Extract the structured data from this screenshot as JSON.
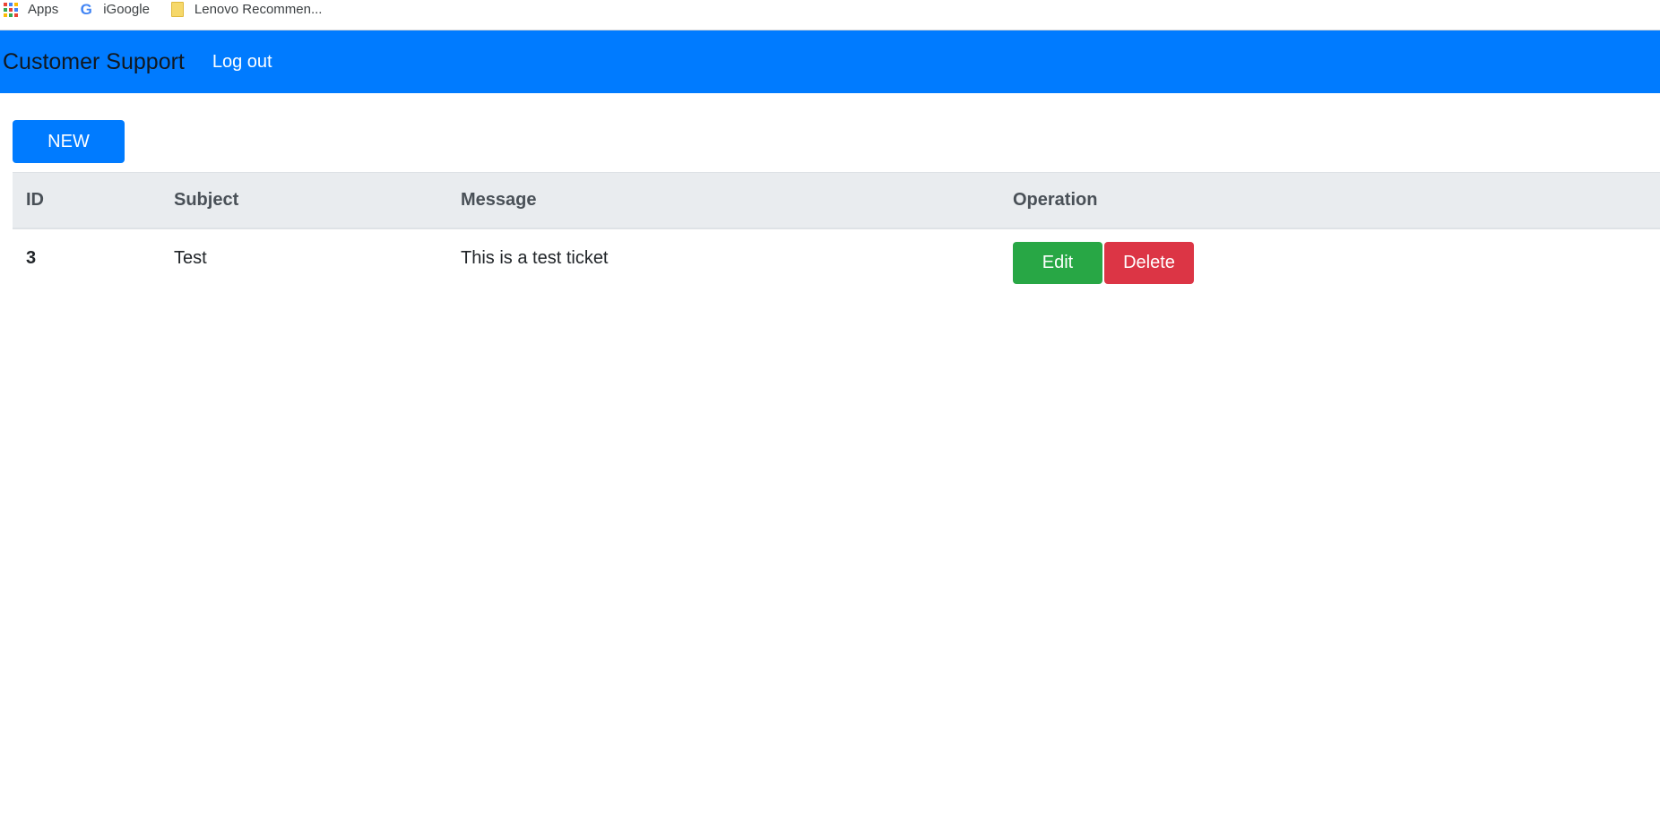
{
  "bookmarks": [
    {
      "label": "Apps",
      "icon": "apps-grid-icon"
    },
    {
      "label": "iGoogle",
      "icon": "google-icon"
    },
    {
      "label": "Lenovo Recommen...",
      "icon": "folder-icon"
    }
  ],
  "navbar": {
    "brand": "Customer Support",
    "logout": "Log out",
    "color": "#007bff"
  },
  "actions": {
    "new_label": "NEW"
  },
  "table": {
    "headers": [
      "ID",
      "Subject",
      "Message",
      "Operation"
    ],
    "rows": [
      {
        "id": "3",
        "subject": "Test",
        "message": "This is a test ticket",
        "edit_label": "Edit",
        "delete_label": "Delete"
      }
    ]
  },
  "colors": {
    "primary": "#007bff",
    "success": "#28a745",
    "danger": "#dc3545",
    "header_bg": "#e9ecef"
  }
}
